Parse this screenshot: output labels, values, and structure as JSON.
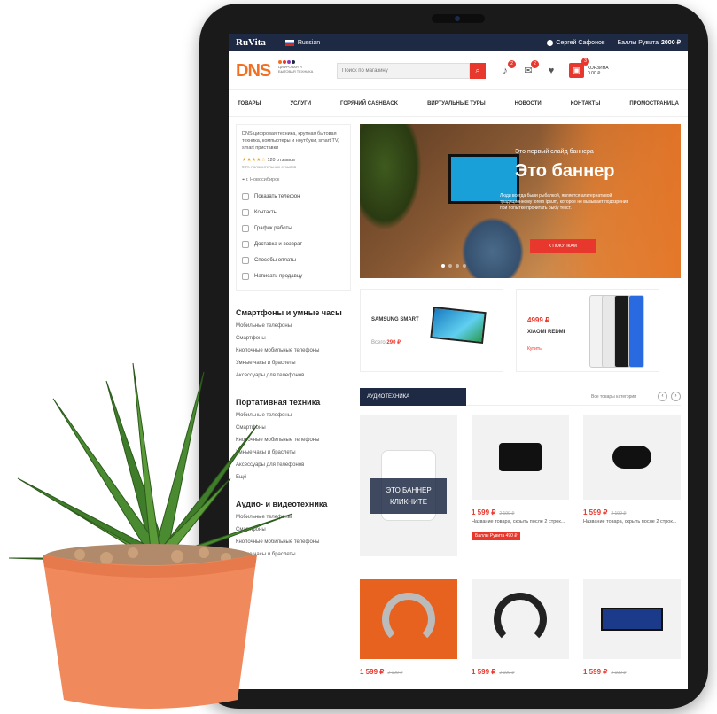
{
  "topbar": {
    "brand": "RuVita",
    "language": "Russian",
    "user": "Сергей Сафонов",
    "points_label": "Баллы Рувита",
    "points_value": "2000 ₽"
  },
  "header": {
    "logo": "DNS",
    "logo_tagline": "ЦИФРОВАЯ И БЫТОВАЯ ТЕХНИКА",
    "search_placeholder": "Поиск по магазину",
    "compare_count": "2",
    "messages_count": "2",
    "cart_count": "3",
    "cart_label": "КОРЗИНА",
    "cart_sum": "0.00 ₽"
  },
  "nav": [
    "ТОВАРЫ",
    "УСЛУГИ",
    "ГОРЯЧИЙ CASHBACK",
    "ВИРТУАЛЬНЫЕ ТУРЫ",
    "НОВОСТИ",
    "КОНТАКТЫ",
    "ПРОМОСТРАНИЦА"
  ],
  "store_card": {
    "description": "DNS цифровая техника, крупная бытовая техника, компьютеры и ноутбуки, smart TV, smart приставки",
    "stars": "★★★★☆",
    "reviews": "120 отзывов",
    "positive": "98% положительных отзывов",
    "city": "г. Новосибирск"
  },
  "store_menu": [
    "Показать телефон",
    "Контакты",
    "График работы",
    "Доставка и возврат",
    "Способы оплаты",
    "Написать продавцу"
  ],
  "categories": [
    {
      "title": "Смартфоны и умные часы",
      "items": [
        "Мобильные телефоны",
        "Смартфоны",
        "Кнопочные мобильные телефоны",
        "Умные часы и браслеты",
        "Аксессуары для телефонов"
      ]
    },
    {
      "title": "Портативная техника",
      "items": [
        "Мобильные телефоны",
        "Смартфоны",
        "Кнопочные мобильные телефоны",
        "Умные часы и браслеты",
        "Аксессуары для телефонов",
        "Ещё"
      ]
    },
    {
      "title": "Аудио- и видеотехника",
      "items": [
        "Мобильные телефоны",
        "Смартфоны",
        "Кнопочные мобильные телефоны",
        "Умные часы и браслеты"
      ]
    }
  ],
  "banner": {
    "subtitle": "Это первый слайд баннера",
    "title": "Это баннер",
    "text": "Люди всегда были рыбалкой, является альтернативой традиционному lorem ipsum, которое не вызывает подозрения при попытке прочитать рыбу текст.",
    "button": "К ПОКУПКАМ"
  },
  "promo1": {
    "name": "SAMSUNG SMART",
    "price_prefix": "Всего",
    "price": "290 ₽"
  },
  "promo2": {
    "price": "4999 ₽",
    "name": "XIAOMI REDMI",
    "link": "Купить!"
  },
  "section": {
    "tab": "АУДИОТЕХНИКА",
    "all_link": "Все товары категории",
    "prev": "‹",
    "next": "›"
  },
  "ad_card": {
    "line1": "ЭТО БАННЕР",
    "line2": "КЛИКНИТЕ"
  },
  "products": [
    {
      "price": "1 599 ₽",
      "old": "2 199 ₽",
      "name": "Название товара, скрыть после 2 строк...",
      "points": "Баллы Рувита 490 ₽"
    },
    {
      "price": "1 599 ₽",
      "old": "2 199 ₽",
      "name": "Название товара, скрыть после 2 строк..."
    },
    {
      "price": "1 599 ₽",
      "old": "2 199 ₽"
    },
    {
      "price": "1 599 ₽",
      "old": "2 199 ₽"
    },
    {
      "price": "1 599 ₽",
      "old": "2 199 ₽"
    }
  ],
  "colors": {
    "accent": "#e8372c",
    "brand_orange": "#f26f21",
    "navy": "#1e2a44",
    "pot": "#f08a5d",
    "leaf": "#3f7d2a"
  }
}
